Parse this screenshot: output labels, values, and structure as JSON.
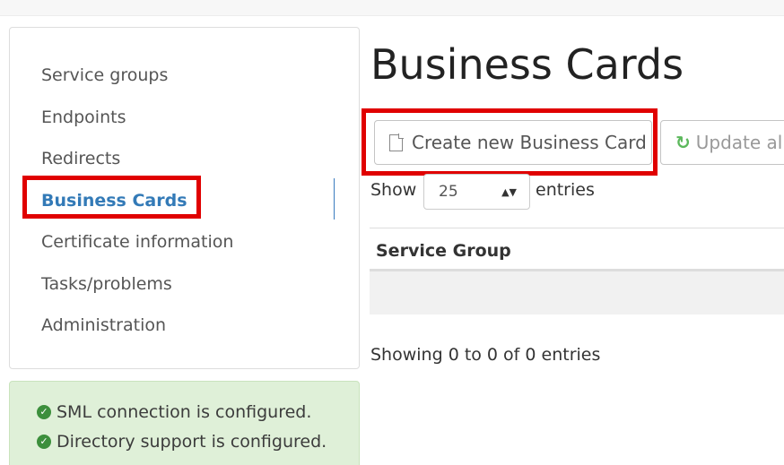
{
  "nav": {
    "items": [
      {
        "label": "Service groups"
      },
      {
        "label": "Endpoints"
      },
      {
        "label": "Redirects"
      },
      {
        "label": "Business Cards"
      },
      {
        "label": "Certificate information"
      },
      {
        "label": "Tasks/problems"
      },
      {
        "label": "Administration"
      }
    ],
    "active_index": 3
  },
  "status": {
    "lines": [
      {
        "text": "SML connection is configured.",
        "icon": "check-circle-icon"
      },
      {
        "text": "Directory support is configured.",
        "icon": "check-circle-icon"
      }
    ],
    "color": "#dff0d8"
  },
  "main": {
    "title": "Business Cards",
    "buttons": {
      "create": {
        "label": "Create new Business Card",
        "icon": "file-icon"
      },
      "update": {
        "label": "Update al",
        "icon": "refresh-icon"
      }
    },
    "length_menu": {
      "prefix": "Show",
      "value": "25",
      "suffix": "entries"
    },
    "table": {
      "columns": [
        "Service Group"
      ],
      "rows": []
    },
    "info": "Showing 0 to 0 of 0 entries"
  },
  "colors": {
    "accent": "#337ab7",
    "highlight": "#e00000",
    "success": "#3c8f3c"
  }
}
